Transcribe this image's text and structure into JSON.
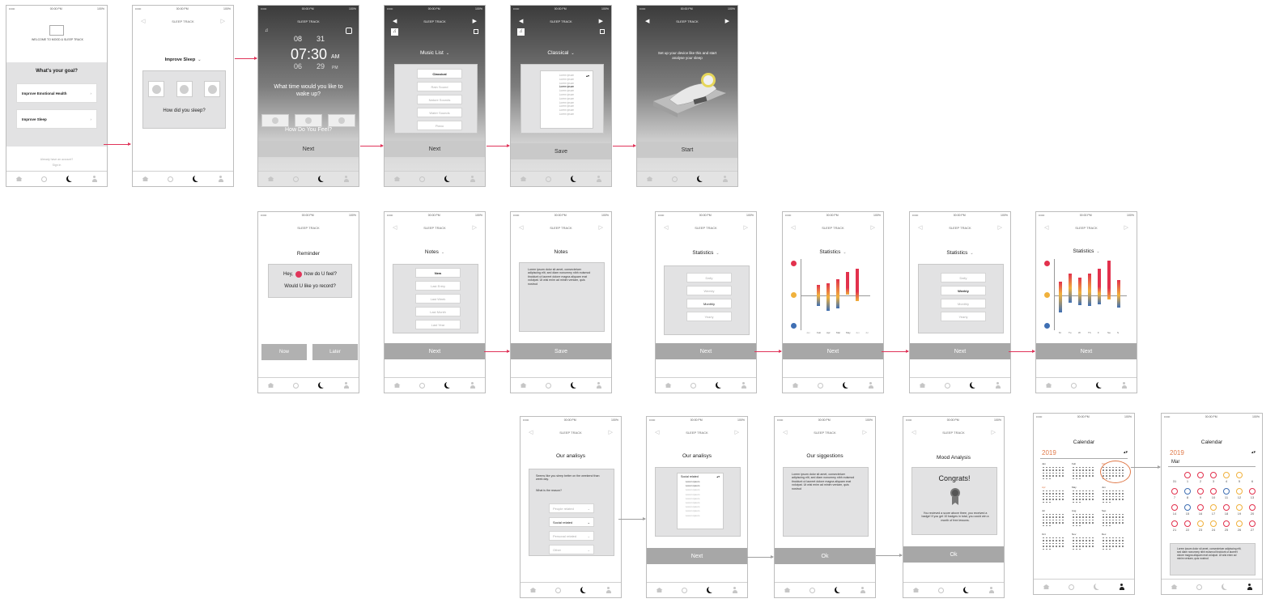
{
  "status": {
    "carrier": "•••••• ",
    "time": "00:00 PM",
    "battery": "100%"
  },
  "app": {
    "title": "SLEEP TRACK"
  },
  "tabs": {
    "home": "home-icon",
    "mood": "mood-icon",
    "sleep": "moon-icon",
    "profile": "user-icon"
  },
  "colors": {
    "accent_red": "#e0355a",
    "bar_top": "#e2314d",
    "bar_mid": "#f0b13c",
    "bar_bottom": "#3f6fb3",
    "calendar_year": "#e07a4a"
  },
  "screen1": {
    "welcome": "WELCOME TO MOOD & SLEEP TRACK",
    "question": "What's your goal?",
    "goal1": "Improve Emotional Health",
    "goal2": "Improve Sleep",
    "footer1": "Already have an account?",
    "footer2": "Sign in"
  },
  "screen2": {
    "title": "Improve Sleep",
    "question": "How did you sleep?"
  },
  "screen3": {
    "h1": "08",
    "m1": "31",
    "hour": "07:30",
    "ampm": "AM",
    "h2": "06",
    "m2": "29",
    "pm": "PM",
    "question": "What time would you like to wake up?",
    "feel": "How Do You Feel?",
    "next": "Next"
  },
  "screen4": {
    "title": "Music List",
    "items": [
      "Classical",
      "Rain Sound",
      "Nature Sounds",
      "Water Sounds",
      "Piano"
    ],
    "next": "Next"
  },
  "screen5": {
    "title": "Classical",
    "items": [
      "Lorem ipsum",
      "Lorem ipsum",
      "Lorem ipsum",
      "Lorem ipsum",
      "Lorem ipsum",
      "Lorem ipsum",
      "Lorem ipsum",
      "Lorem ipsum",
      "Lorem ipsum",
      "Lorem ipsum",
      "Lorem ipsum"
    ],
    "save": "Save"
  },
  "screen6": {
    "text": "Set up your device like this and start analyse your sleep",
    "start": "Start"
  },
  "screen7": {
    "title": "Reminder",
    "line1a": "Hey,",
    "line1b": "how do U feel?",
    "line2": "Would U like yo record?",
    "now": "Now",
    "later": "Later"
  },
  "screen8": {
    "title": "Notes",
    "items": [
      "New",
      "Last Entry",
      "Last Week",
      "Last Month",
      "Last Year"
    ],
    "next": "Next"
  },
  "screen9": {
    "title": "Notes",
    "body": "Lorem ipsum dolor sit amet, consectetuer adipiscing elit, sed diam nonummy nibh euismod tincidunt ut laoreet dolore magna aliquam erat volutpat. Ut wisi enim ad minim veniam, quis nostrud",
    "save": "Save"
  },
  "screen10": {
    "title": "Statistics",
    "items": [
      "Daily",
      "Weekly",
      "Monthly",
      "Yearly"
    ],
    "next": "Next"
  },
  "screen11": {
    "title": "Statistics",
    "next": "Next",
    "months": [
      "Jan",
      "Feb",
      "Apr",
      "Mar",
      "May",
      "Jun",
      "Jul"
    ]
  },
  "screen12": {
    "title": "Statistics",
    "items": [
      "Daily",
      "Weekly",
      "Monthly",
      "Yearly"
    ],
    "next": "Next"
  },
  "screen13": {
    "title": "Statistics",
    "next": "Next",
    "days": [
      "M",
      "Tu",
      "W",
      "Th",
      "F",
      "Sa",
      "S"
    ]
  },
  "screen14": {
    "title": "Our analisys",
    "text1": "Seems like you sleep better on the weekend than week day.",
    "text2": "What is the reason?",
    "options": [
      "People related",
      "Social related",
      "Personal related",
      "Other"
    ]
  },
  "screen15": {
    "title": "Our analisys",
    "selected": "Social related",
    "items": [
      "Lorem ipsum",
      "Lorem ipsum",
      "Lorem ipsum",
      "Lorem ipsum",
      "Lorem ipsum",
      "Lorem ipsum",
      "Lorem ipsum",
      "Lorem ipsum",
      "Lorem ipsum"
    ],
    "next": "Next"
  },
  "screen16": {
    "title": "Our siggestions",
    "body": "Lorem ipsum dolor sit amet, consectetuer adipiscing elit, sed diam nonummy nibh euismod tincidunt ut laoreet dolore magna aliquam erat volutpat. Ut wisi enim ad minim veniam, quis nostrud",
    "ok": "Ok"
  },
  "screen17": {
    "title": "Mood Analysis",
    "congrats": "Congrats!",
    "body": "You recieved a score above three, you received a badge! If you get 10 badges in total, you could win a month of free lessons.",
    "ok": "Ok"
  },
  "screen18": {
    "title": "Calendar",
    "year": "2019",
    "months": [
      "Jan",
      "Feb",
      "Mar",
      "Apr",
      "May",
      "Jun",
      "Jul",
      "Aug",
      "Sep",
      "Oct",
      "Nov",
      "Dec"
    ]
  },
  "screen19": {
    "title": "Calendar",
    "year": "2019",
    "month": "Mar",
    "days": [
      "31",
      "1",
      "2",
      "3",
      "4",
      "5",
      "6",
      "7",
      "8",
      "9",
      "10",
      "11",
      "12",
      "13",
      "14",
      "15",
      "16",
      "17",
      "18",
      "19",
      "20",
      "21",
      "22",
      "23",
      "24",
      "25",
      "26",
      "27"
    ],
    "body": "Lorem ipsum dolor sit amet, consectetuer adipiscing elit, sed diam nonummy nibh euismod tincidunt ut laoreet dolore magna aliquam erat volutpat. Ut wisi enim ad minim veniam, quis nostrud"
  }
}
